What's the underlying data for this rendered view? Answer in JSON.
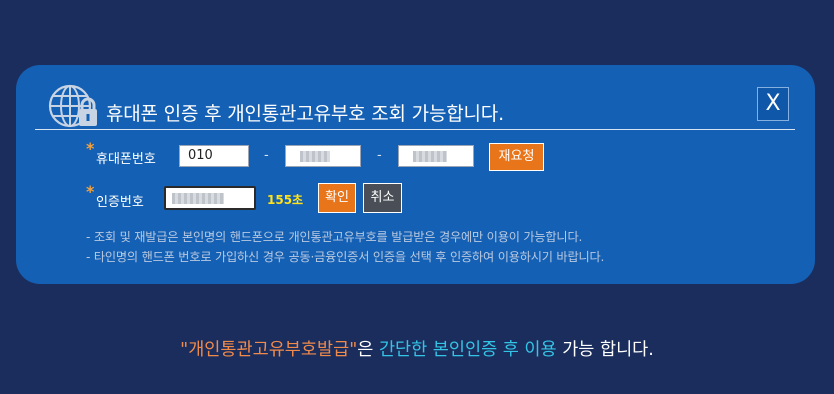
{
  "panel": {
    "title": "휴대폰 인증 후 개인통관고유부호 조회 가능합니다.",
    "close_label": "X"
  },
  "phone": {
    "star": "*",
    "label": "휴대폰번호",
    "prefix_value": "010",
    "dash": "-",
    "resend_label": "재요청"
  },
  "verify": {
    "star": "*",
    "label": "인증번호",
    "timer": "155초",
    "confirm_label": "확인",
    "cancel_label": "취소"
  },
  "notes": [
    "- 조회 및 재발급은 본인명의 핸드폰으로 개인통관고유부호를 발급받은 경우에만 이용이 가능합니다.",
    "- 타인명의 핸드폰 번호로 가입하신 경우 공동·금융인증서 인증을 선택 후 인증하여 이용하시기 바랍니다."
  ],
  "footer": {
    "part1": "\"개인통관고유부호발급\"",
    "part2": "은 ",
    "part3": "간단한 본인인증 후 이용",
    "part4": " 가능 합니다."
  },
  "icons": [
    "globe-lock-icon",
    "close-icon"
  ],
  "colors": {
    "page_bg": "#1b2d5c",
    "panel_bg": "#1460b4",
    "accent_orange": "#e8751a",
    "timer_yellow": "#ffe21a",
    "footer_cyan": "#33c4e6",
    "footer_orange": "#f08a4b"
  }
}
